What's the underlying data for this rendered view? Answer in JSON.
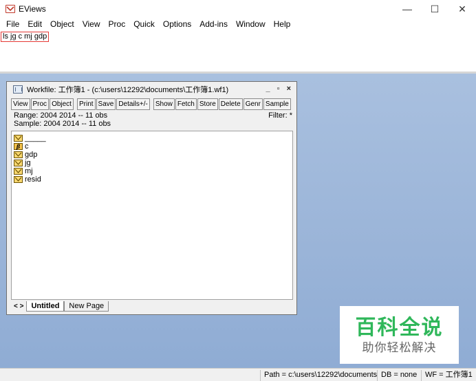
{
  "window": {
    "title": "EViews",
    "controls": [
      "—",
      "☐",
      "✕"
    ]
  },
  "menu": [
    "File",
    "Edit",
    "Object",
    "View",
    "Proc",
    "Quick",
    "Options",
    "Add-ins",
    "Window",
    "Help"
  ],
  "command": {
    "text": "ls jg c mj gdp"
  },
  "workfile": {
    "title": "Workfile: 工作簿1 - (c:\\users\\12292\\documents\\工作簿1.wf1)",
    "controls": [
      "_",
      "▫",
      "×"
    ],
    "toolbar_left": [
      "View",
      "Proc",
      "Object"
    ],
    "toolbar_right": [
      "Print",
      "Save",
      "Details+/-",
      "Show",
      "Fetch",
      "Store",
      "Delete",
      "Genr",
      "Sample"
    ],
    "range": "Range:  2004 2014  --  11 obs",
    "sample": "Sample: 2004 2014  --  11 obs",
    "filter": "Filter: *",
    "objects": [
      {
        "name": "_____",
        "icon": "series-icon"
      },
      {
        "name": "c",
        "icon": "coef-icon"
      },
      {
        "name": "gdp",
        "icon": "series-icon"
      },
      {
        "name": "jg",
        "icon": "series-icon"
      },
      {
        "name": "mj",
        "icon": "series-icon"
      },
      {
        "name": "resid",
        "icon": "series-icon"
      }
    ],
    "tab_arrows": "< >",
    "tabs": [
      "Untitled",
      "New Page"
    ]
  },
  "watermark": {
    "title": "百科全说",
    "subtitle": "助你轻松解决"
  },
  "status": {
    "path": "Path = c:\\users\\12292\\documents",
    "db": "DB = none",
    "wf": "WF = 工作簿1"
  },
  "colors": {
    "desktop": "#9ab4d8",
    "watermark_green": "#2fb75a",
    "command_highlight": "#e53935"
  }
}
